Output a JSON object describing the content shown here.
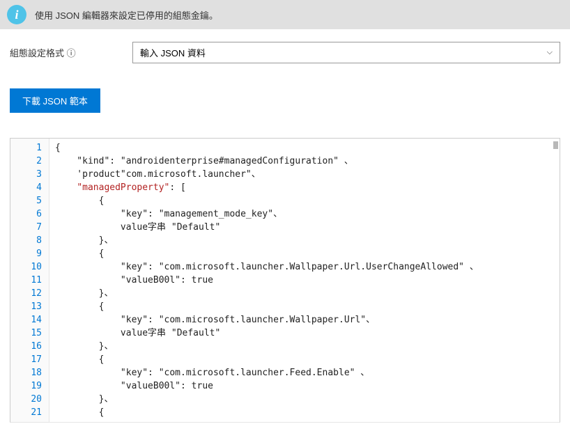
{
  "banner": {
    "icon_label": "i",
    "text": "使用 JSON 編輯器來設定已停用的組態金鑰。"
  },
  "form": {
    "format_label": "組態設定格式 ⓘ",
    "dropdown_value": "輸入 JSON 資料"
  },
  "buttons": {
    "download_template": "下載 JSON 範本"
  },
  "editor": {
    "lines": [
      {
        "num": "1",
        "text": "{",
        "pipe": true
      },
      {
        "num": "2",
        "text": "    \"kind\": \"androidenterprise#managedConfiguration\" 、"
      },
      {
        "num": "3",
        "text": "    'product\"com.microsoft.launcher\"、"
      },
      {
        "num": "4",
        "prefix": "    ",
        "red_key": "\"managedProperty\"",
        "suffix": ": ["
      },
      {
        "num": "5",
        "text": "        {"
      },
      {
        "num": "6",
        "text": "            \"key\": \"management_mode_key\"、"
      },
      {
        "num": "7",
        "text": "            value字串 \"Default\""
      },
      {
        "num": "8",
        "text": "        }、"
      },
      {
        "num": "9",
        "text": "        {"
      },
      {
        "num": "10",
        "text": "            \"key\": \"com.microsoft.launcher.Wallpaper.Url.UserChangeAllowed\" 、"
      },
      {
        "num": "11",
        "text": "            \"valueB00l\": true"
      },
      {
        "num": "12",
        "text": "        }、"
      },
      {
        "num": "13",
        "text": "        {"
      },
      {
        "num": "14",
        "text": "            \"key\": \"com.microsoft.launcher.Wallpaper.Url\"、"
      },
      {
        "num": "15",
        "text": "            value字串 \"Default\""
      },
      {
        "num": "16",
        "text": "        }、"
      },
      {
        "num": "17",
        "text": "        {"
      },
      {
        "num": "18",
        "text": "            \"key\": \"com.microsoft.launcher.Feed.Enable\" 、"
      },
      {
        "num": "19",
        "text": "            \"valueB00l\": true"
      },
      {
        "num": "20",
        "text": "        }、"
      },
      {
        "num": "21",
        "text": "        {"
      }
    ]
  }
}
